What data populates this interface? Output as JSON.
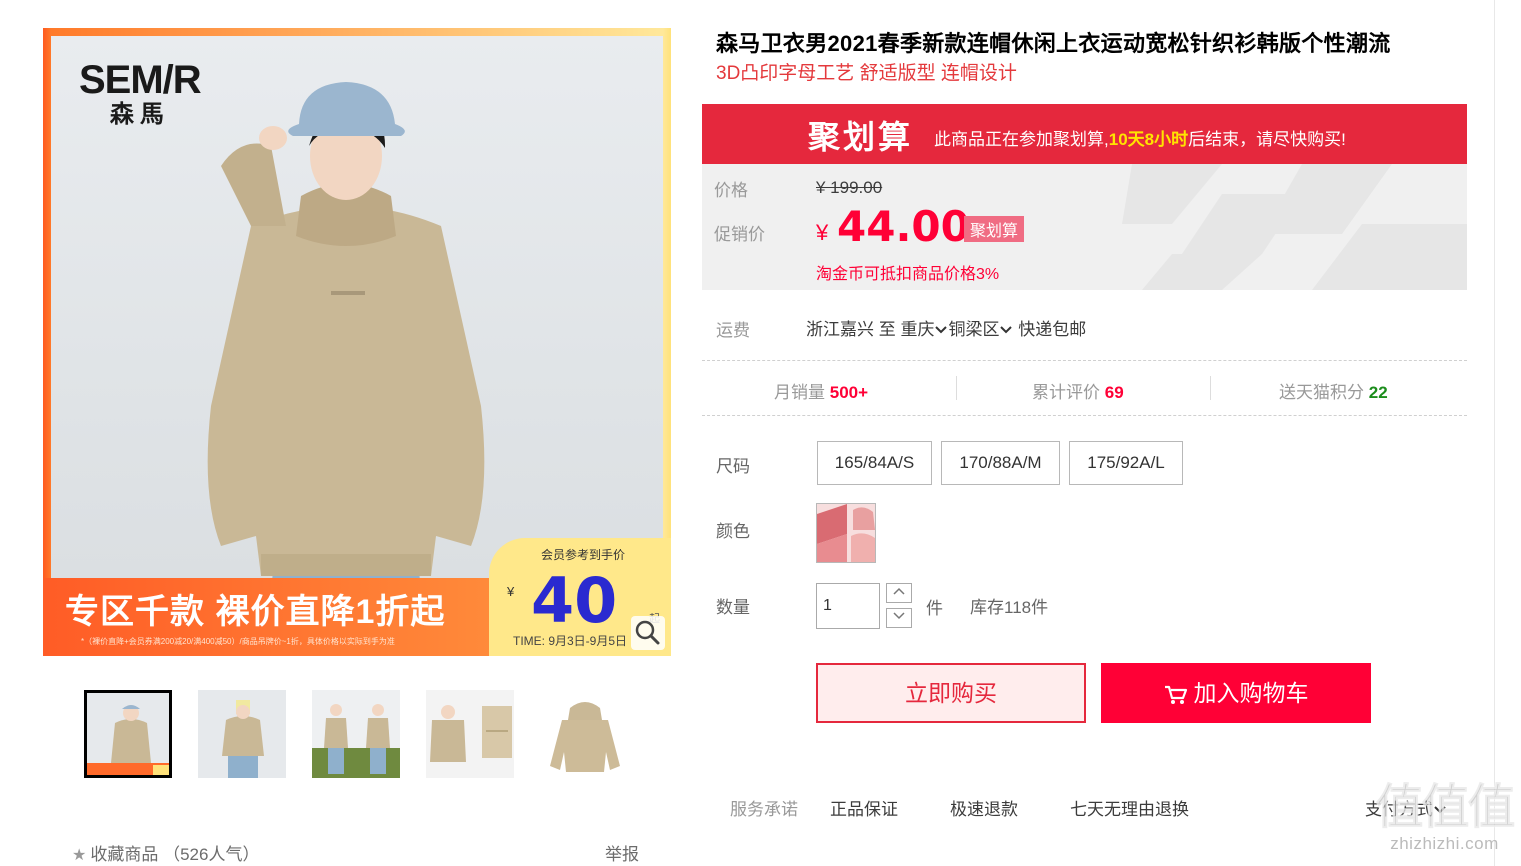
{
  "gallery": {
    "logo_en": "SEM/R",
    "logo_cn": "森馬",
    "promo_main": "专区千款 裸价直降1折起",
    "promo_fine": "*（裸价直降+会员券满200减20/满400减50）/商品吊牌价~1折，具体价格以实际到手为准",
    "member_title": "会员参考到手价",
    "member_yen": "¥",
    "member_price": "40",
    "member_qi": "起",
    "member_time": "TIME: 9月3日-9月5日",
    "thumb_count": 5
  },
  "favorites": {
    "label": "收藏商品",
    "popularity": "（526人气）",
    "report": "举报"
  },
  "product": {
    "title": "森马卫衣男2021春季新款连帽休闲上衣运动宽松针织衫韩版个性潮流",
    "subtitle": "3D凸印字母工艺 舒适版型 连帽设计"
  },
  "juhuasuan": {
    "logo": "聚划算",
    "text_before": "此商品正在参加聚划算,",
    "highlight": "10天8小时",
    "text_after": "后结束，请尽快购买!"
  },
  "price": {
    "label_price": "价格",
    "original": "¥ 199.00",
    "label_promo": "促销价",
    "yen": "¥",
    "promo": "44.00",
    "tag": "聚划算",
    "coin_note": "淘金币可抵扣商品价格3%"
  },
  "shipping": {
    "label": "运费",
    "from": "浙江嘉兴",
    "to_word": "至",
    "city": "重庆",
    "district": "铜梁区",
    "method": "快递包邮"
  },
  "stats": {
    "monthly_label": "月销量",
    "monthly_value": "500+",
    "reviews_label": "累计评价",
    "reviews_value": "69",
    "points_label": "送天猫积分",
    "points_value": "22"
  },
  "options": {
    "size_label": "尺码",
    "sizes": [
      "165/84A/S",
      "170/88A/M",
      "175/92A/L"
    ],
    "color_label": "颜色",
    "qty_label": "数量",
    "qty_value": "1",
    "qty_unit": "件",
    "stock": "库存118件"
  },
  "actions": {
    "buy_now": "立即购买",
    "add_cart": "加入购物车"
  },
  "services": {
    "label": "服务承诺",
    "items": [
      "正品保证",
      "极速退款",
      "七天无理由退换"
    ],
    "pay": "支付方式"
  },
  "watermark": {
    "logo": "值值值",
    "site": "zhizhizhi.com"
  },
  "colors": {
    "tmall_red": "#ff0036",
    "jhs_red": "#e5283d",
    "highlight_yellow": "#ffe400",
    "points_green": "#1c8d1c",
    "member_blue": "#2a2ad0"
  }
}
